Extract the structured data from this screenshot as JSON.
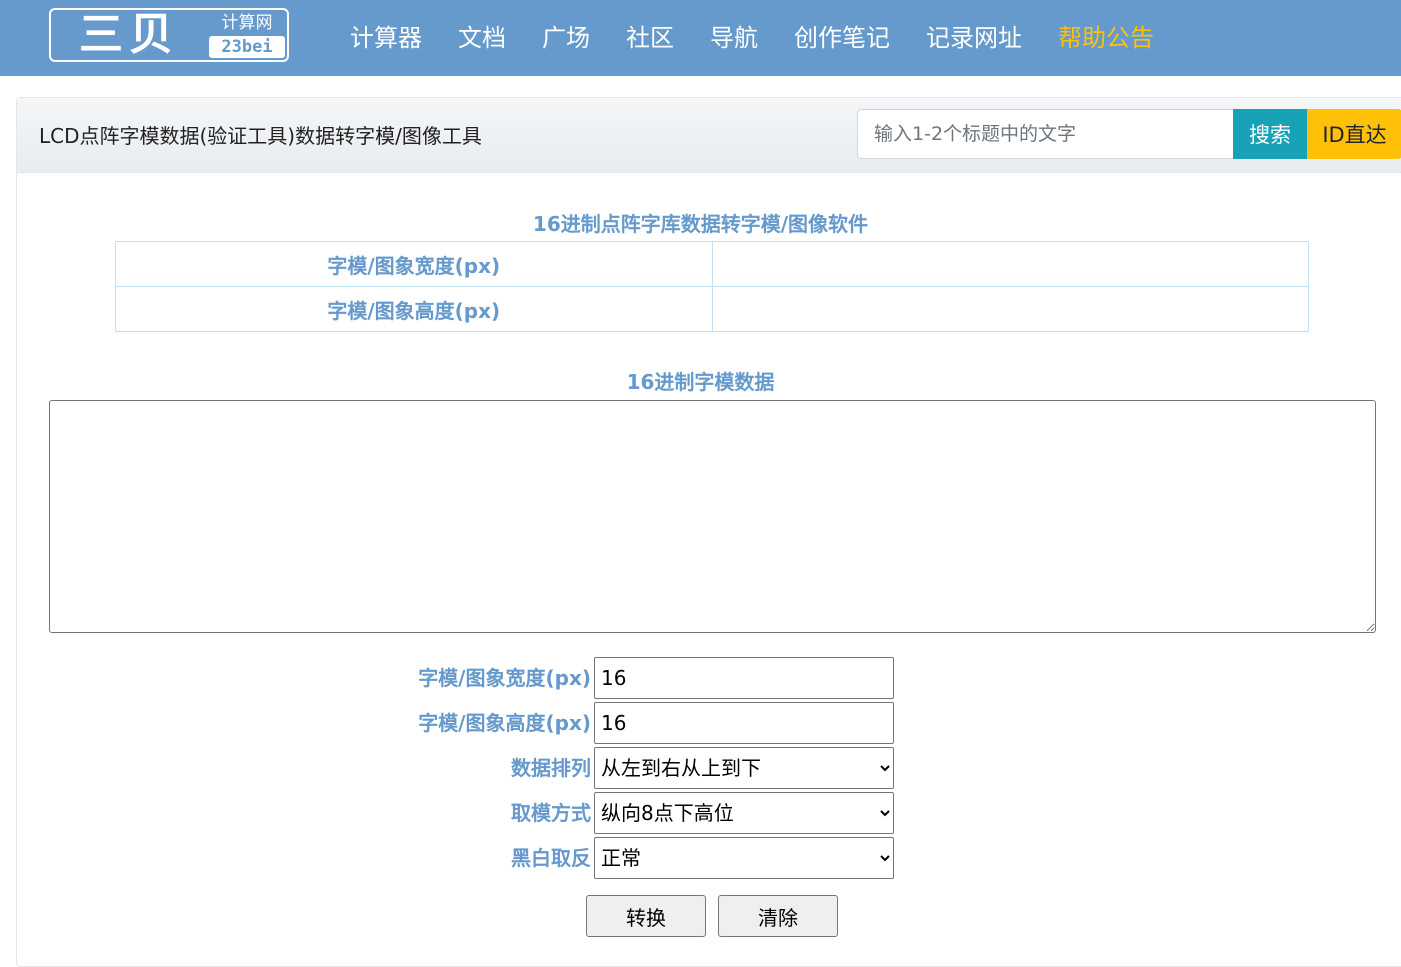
{
  "logo": {
    "main": "三贝",
    "top": "计算网",
    "bottom": "23bei"
  },
  "nav": [
    {
      "label": "计算器",
      "active": false
    },
    {
      "label": "文档",
      "active": false
    },
    {
      "label": "广场",
      "active": false
    },
    {
      "label": "社区",
      "active": false
    },
    {
      "label": "导航",
      "active": false
    },
    {
      "label": "创作笔记",
      "active": false
    },
    {
      "label": "记录网址",
      "active": false
    },
    {
      "label": "帮助公告",
      "active": true
    }
  ],
  "header": {
    "title": "LCD点阵字模数据(验证工具)数据转字模/图像工具",
    "search_placeholder": "输入1-2个标题中的文字",
    "search_button": "搜索",
    "id_button": "ID直达"
  },
  "info": {
    "title": "16进制点阵字库数据转字模/图像软件",
    "rows": [
      {
        "label": "字模/图象宽度(px)",
        "value": ""
      },
      {
        "label": "字模/图象高度(px)",
        "value": ""
      }
    ]
  },
  "hex": {
    "title": "16进制字模数据",
    "value": ""
  },
  "form": {
    "width_label": "字模/图象宽度(px)",
    "width_value": "16",
    "height_label": "字模/图象高度(px)",
    "height_value": "16",
    "order_label": "数据排列",
    "order_selected": "从左到右从上到下",
    "mode_label": "取模方式",
    "mode_selected": "纵向8点下高位",
    "invert_label": "黑白取反",
    "invert_selected": "正常"
  },
  "buttons": {
    "convert": "转换",
    "clear": "清除"
  },
  "colors": {
    "nav_bg": "#6699cc",
    "nav_active": "#ffc107",
    "label_blue": "#6699cc",
    "search_btn": "#17a2b8",
    "id_btn": "#ffc107",
    "table_border": "#bfe3f0"
  }
}
